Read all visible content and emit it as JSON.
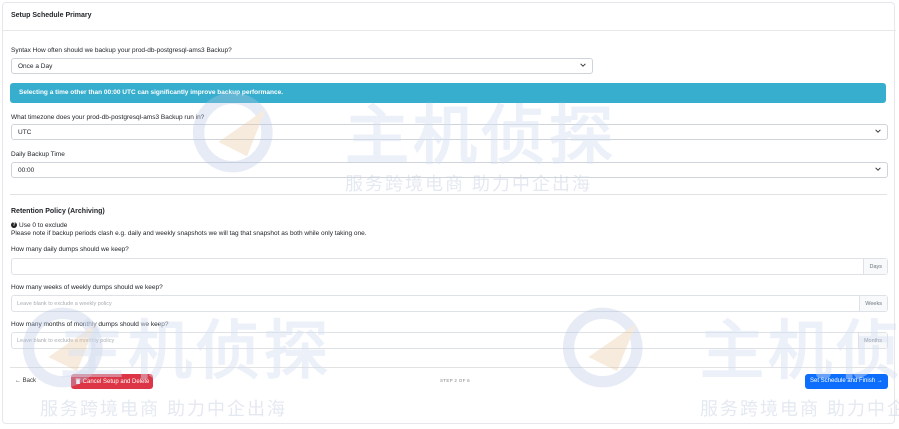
{
  "panel": {
    "title": "Setup Schedule Primary"
  },
  "frequency": {
    "label": "Syntax How often should we backup your prod-db-postgresql-ams3 Backup?",
    "value": "Once a Day"
  },
  "info_alert": {
    "text": "Selecting a time other than 00:00 UTC can significantly improve backup performance."
  },
  "timezone": {
    "label": "What timezone does your prod-db-postgresql-ams3 Backup run in?",
    "value": "UTC"
  },
  "backup_time": {
    "label": "Daily Backup Time",
    "value": "00:00"
  },
  "retention": {
    "title": "Retention Policy (Archiving)",
    "help_line1": "Use 0 to exclude",
    "help_line2": "Please note if backup periods clash e.g. daily and weekly snapshots we will tag that snapshot as both while only taking one.",
    "daily": {
      "label": "How many daily dumps should we keep?",
      "placeholder": "",
      "unit": "Days"
    },
    "weekly": {
      "label": "How many weeks of weekly dumps should we keep?",
      "placeholder": "Leave blank to exclude a weekly policy",
      "unit": "Weeks"
    },
    "monthly": {
      "label": "How many months of monthly dumps should we keep?",
      "placeholder": "Leave blank to exclude a monthly policy",
      "unit": "Months"
    }
  },
  "footer": {
    "back_label": "← Back",
    "delete_label": "Cancel Setup and Delete",
    "step_text": "STEP 2 OF 6",
    "finish_label": "Set Schedule and Finish →"
  },
  "watermark": {
    "brand_big": "主机侦探",
    "slogan": "服务跨境电商 助力中企出海"
  },
  "colors": {
    "alert_bg": "#37aece",
    "danger": "#dc3545",
    "primary": "#0d6efd"
  }
}
